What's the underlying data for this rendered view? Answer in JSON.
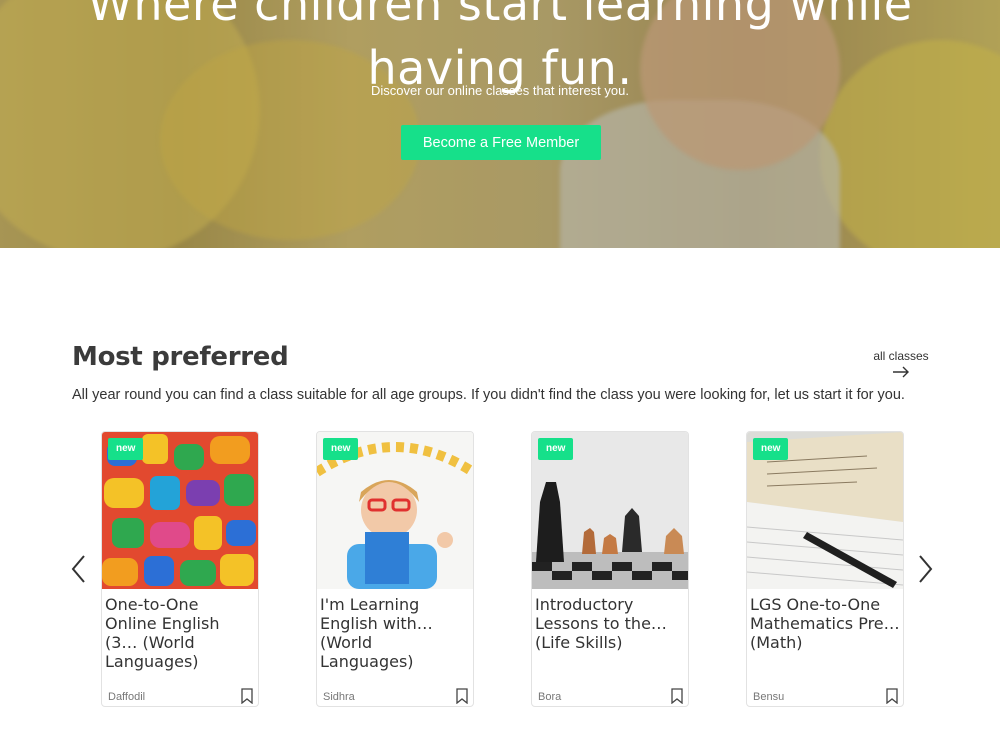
{
  "hero": {
    "title_line1": "Where children start learning while",
    "title_line2": "having fun.",
    "subtitle": "Discover our online classes that interest you.",
    "cta_label": "Become a Free Member"
  },
  "section": {
    "title": "Most preferred",
    "description": "All year round you can find a class suitable for all age groups. If you didn't find the class you were looking for, let us start it for you.",
    "all_classes_label": "all classes",
    "all_classes_icon": "arrow-right-icon"
  },
  "carousel": {
    "prev_icon": "chevron-left-icon",
    "next_icon": "chevron-right-icon",
    "cards": [
      {
        "badge": "new",
        "title": "One-to-One Online English (3… (World Languages)",
        "author": "Daffodil"
      },
      {
        "badge": "new",
        "title": "I'm Learning English with… (World Languages)",
        "author": "Sidhra"
      },
      {
        "badge": "new",
        "title": "Introductory Lessons to the… (Life Skills)",
        "author": "Bora"
      },
      {
        "badge": "new",
        "title": "LGS One-to-One Mathematics Pre… (Math)",
        "author": "Bensu"
      }
    ]
  },
  "colors": {
    "accent": "#16e08a",
    "heading": "#3b3b3b"
  }
}
